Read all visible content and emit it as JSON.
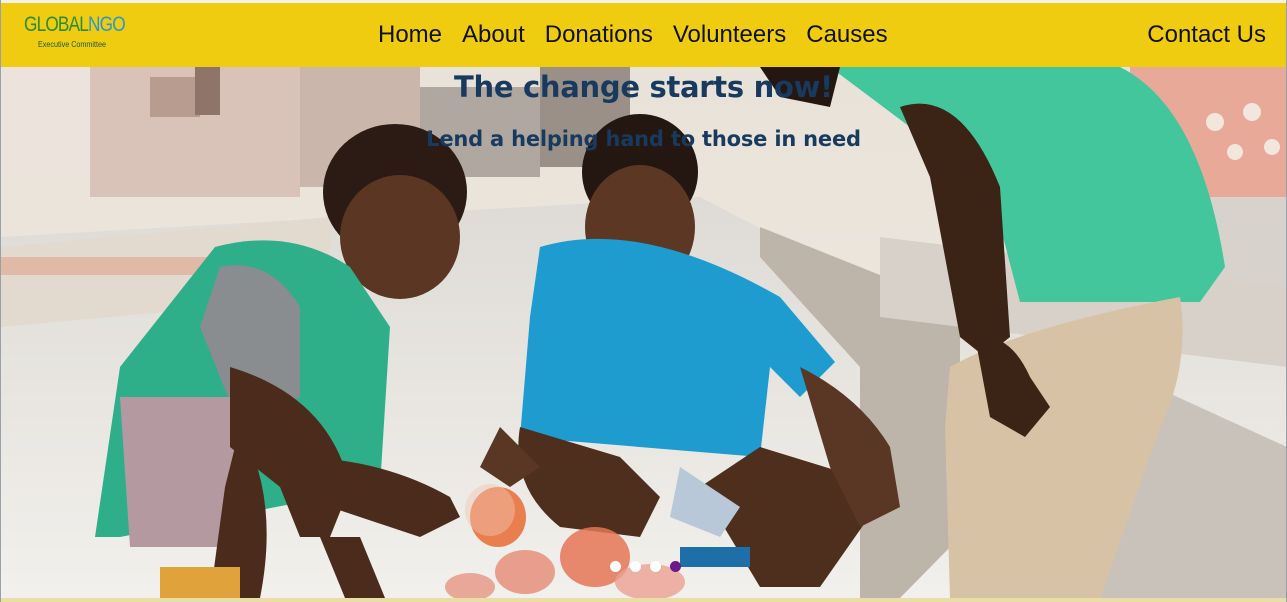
{
  "brand": {
    "logo_main_first": "GLOBAL",
    "logo_main_second": "NGO",
    "logo_sub": "Executive Committee",
    "nav_bg_color": "#efcc0f"
  },
  "nav": {
    "links": [
      "Home",
      "About",
      "Donations",
      "Volunteers",
      "Causes"
    ],
    "contact": "Contact Us"
  },
  "hero": {
    "title": "The change starts now!",
    "subtitle": "Lend a helping hand to those in need",
    "text_color": "#173a5e",
    "slides_count": 4,
    "active_slide": 4,
    "image_description_icon": "photo-children-street"
  }
}
